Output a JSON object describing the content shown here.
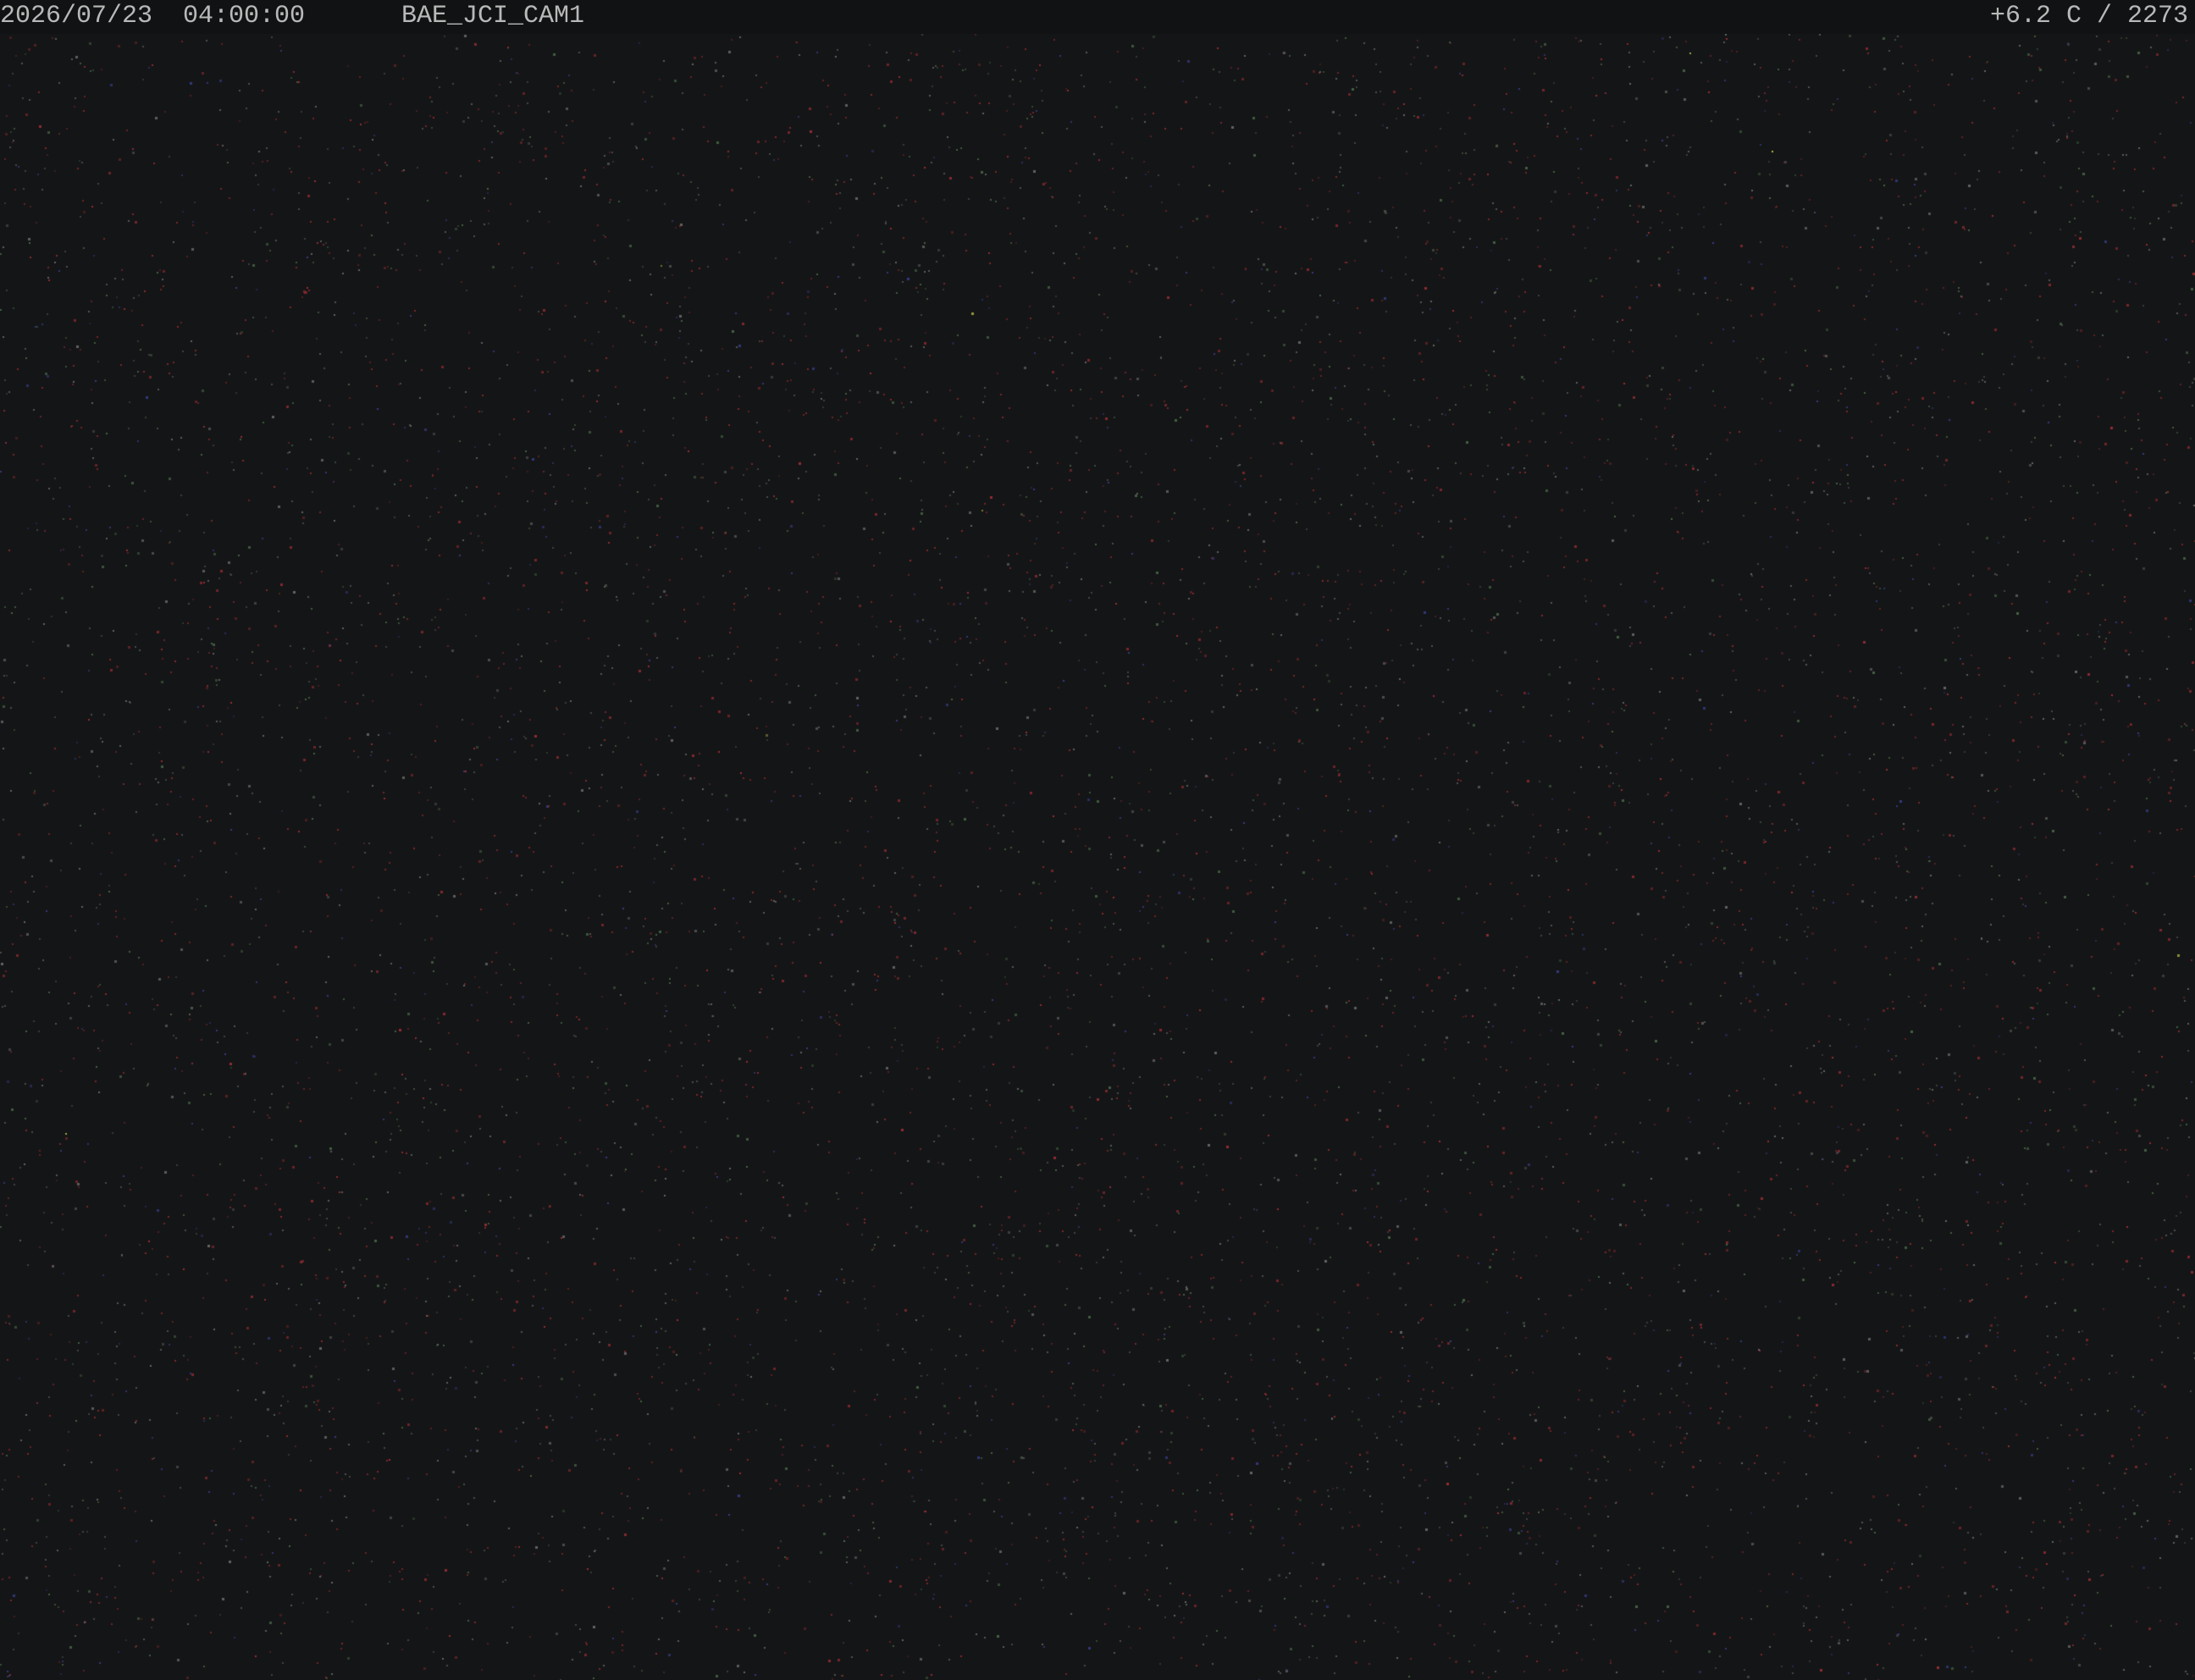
{
  "overlay": {
    "timestamp": "2026/07/23  04:00:00",
    "camera_name": "BAE_JCI_CAM1",
    "temperature_reading": "+6.2 C / 2273"
  },
  "scene": {
    "background_color": "#141516",
    "speckle_colors": [
      "#8a2a30",
      "#a33038",
      "#3a3f8f",
      "#4a6a4a",
      "#6d6d6d",
      "#c8d050"
    ]
  }
}
